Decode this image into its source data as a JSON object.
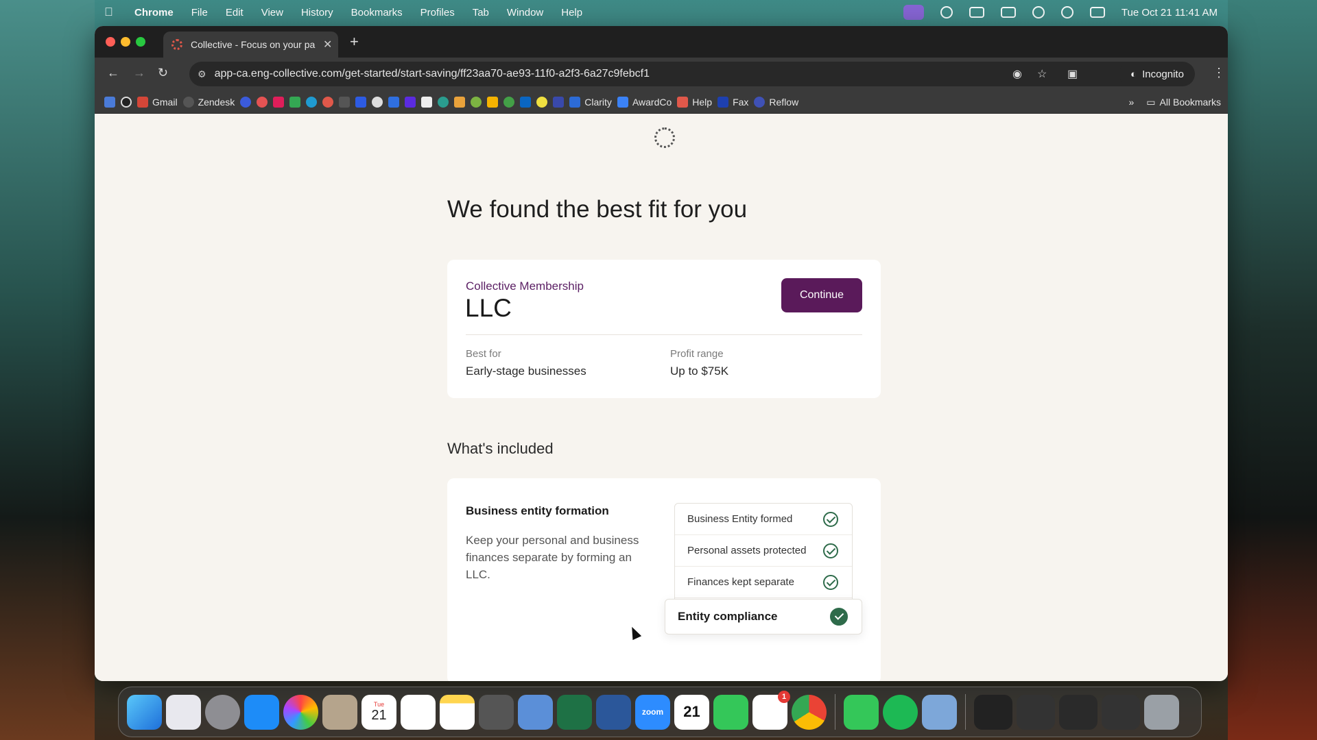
{
  "menubar": {
    "app_name": "Chrome",
    "items": [
      "File",
      "Edit",
      "View",
      "History",
      "Bookmarks",
      "Profiles",
      "Tab",
      "Window",
      "Help"
    ],
    "clock": "Tue Oct 21  11:41 AM"
  },
  "browser": {
    "tab_title": "Collective - Focus on your pa",
    "url": "app-ca.eng-collective.com/get-started/start-saving/ff23aa70-ae93-11f0-a2f3-6a27c9febcf1",
    "incognito_label": "Incognito",
    "bookmarks": {
      "gmail": "Gmail",
      "zendesk": "Zendesk",
      "clarity": "Clarity",
      "awardco": "AwardCo",
      "help": "Help",
      "fax": "Fax",
      "reflow": "Reflow",
      "all_bookmarks": "All Bookmarks"
    }
  },
  "page": {
    "heading": "We found the best fit for you",
    "plan_card": {
      "eyebrow": "Collective Membership",
      "plan_name": "LLC",
      "continue_label": "Continue",
      "best_for_label": "Best for",
      "best_for_value": "Early-stage businesses",
      "profit_range_label": "Profit range",
      "profit_range_value": "Up to $75K"
    },
    "included_heading": "What's included",
    "feature": {
      "title": "Business entity formation",
      "description": "Keep your personal and business finances separate by forming an LLC.",
      "checklist": [
        "Business Entity formed",
        "Personal assets protected",
        "Finances kept separate"
      ],
      "highlight": "Entity compliance"
    }
  },
  "dock": {
    "calendar_day": "21",
    "calendar_month": "Tue",
    "zoom_label": "zoom",
    "slack_badge": "1"
  }
}
